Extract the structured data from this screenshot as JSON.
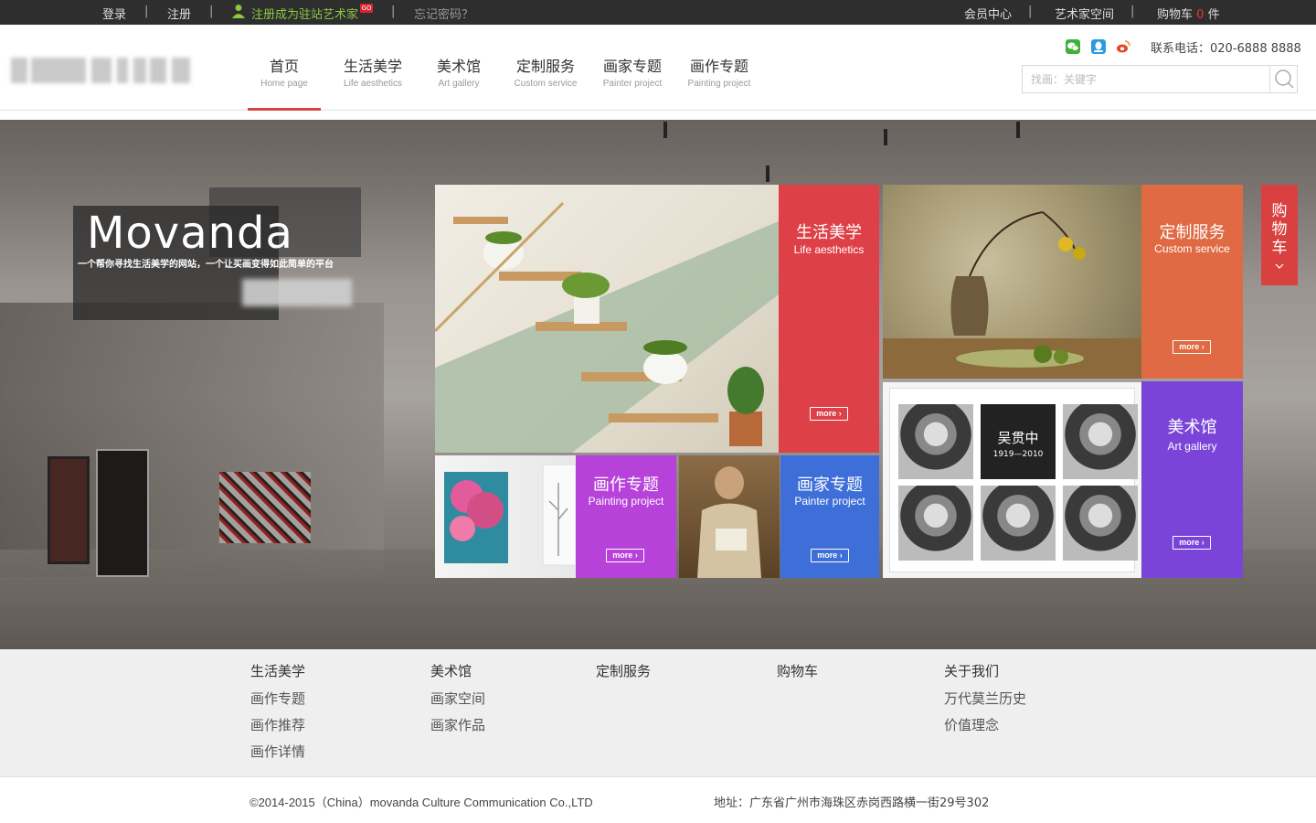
{
  "topbar": {
    "login": "登录",
    "register": "注册",
    "register_artist": "注册成为驻站艺术家",
    "go_badge": "GO",
    "forgot_password": "忘记密码？",
    "member_center": "会员中心",
    "artist_space": "艺术家空间",
    "cart_label": "购物车",
    "cart_count": "0",
    "cart_unit": "件",
    "separator": "|"
  },
  "header": {
    "nav": [
      {
        "cn": "首页",
        "en": "Home page"
      },
      {
        "cn": "生活美学",
        "en": "Life aesthetics"
      },
      {
        "cn": "美术馆",
        "en": "Art gallery"
      },
      {
        "cn": "定制服务",
        "en": "Custom service"
      },
      {
        "cn": "画家专题",
        "en": "Painter project"
      },
      {
        "cn": "画作专题",
        "en": "Painting project"
      }
    ],
    "phone": "联系电话：020-6888 8888",
    "search_placeholder": "找画：关键字",
    "colors": {
      "active": "#d64545",
      "wechat": "#3fb13a",
      "qq": "#2a9be0",
      "weibo": "#e8432c"
    }
  },
  "hero": {
    "brand": "Movanda",
    "tagline": "一个帮你寻找生活美学的网站，一个让买画变得如此简单的平台",
    "tiles": [
      {
        "cn": "生活美学",
        "en": "Life aesthetics",
        "more": "more ›",
        "color": "#dd4147"
      },
      {
        "cn": "定制服务",
        "en": "Custom service",
        "more": "more ›",
        "color": "#e06a43"
      },
      {
        "cn": "画作专题",
        "en": "Painting project",
        "more": "more ›",
        "color": "#b742d9"
      },
      {
        "cn": "画家专题",
        "en": "Painter project",
        "more": "more ›",
        "color": "#3e6fd8"
      },
      {
        "cn": "美术馆",
        "en": "Art gallery",
        "more": "more ›",
        "color": "#7a44d9"
      }
    ],
    "painter_name": "吴贯中",
    "painter_years": "1919—2010",
    "cart_tab": [
      "购",
      "物",
      "车"
    ]
  },
  "footer": {
    "columns": [
      {
        "head": "生活美学",
        "links": [
          "画作专题",
          "画作推荐",
          "画作详情"
        ]
      },
      {
        "head": "美术馆",
        "links": [
          "画家空间",
          "画家作品"
        ]
      },
      {
        "head": "定制服务",
        "links": []
      },
      {
        "head": "购物车",
        "links": []
      },
      {
        "head": "关于我们",
        "links": [
          "万代莫兰历史",
          "价值理念"
        ]
      }
    ],
    "copyright": "©2014-2015（China）movanda Culture Communication Co.,LTD",
    "address": "地址：广东省广州市海珠区赤岗西路横一街29号302"
  }
}
